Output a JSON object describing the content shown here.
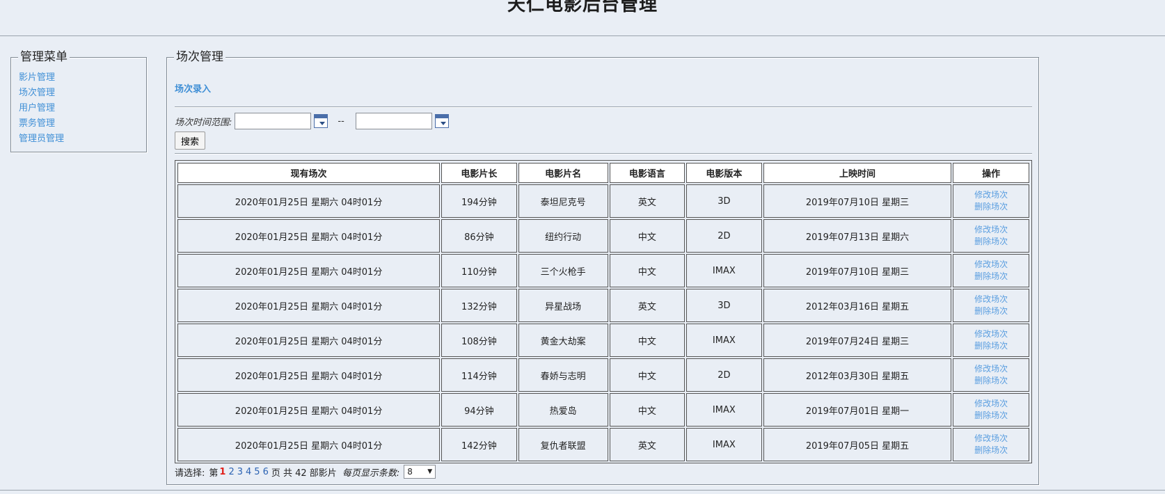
{
  "header": {
    "title": "天仁电影后台管理"
  },
  "menu": {
    "legend": "管理菜单",
    "items": [
      {
        "label": "影片管理"
      },
      {
        "label": "场次管理"
      },
      {
        "label": "用户管理"
      },
      {
        "label": "票务管理"
      },
      {
        "label": "管理员管理"
      }
    ]
  },
  "main": {
    "legend": "场次管理",
    "add_link": "场次录入",
    "filter": {
      "label": "场次时间范围:",
      "separator": "--",
      "start_value": "",
      "end_value": "",
      "search_label": "搜索"
    },
    "table": {
      "headers": [
        "现有场次",
        "电影片长",
        "电影片名",
        "电影语言",
        "电影版本",
        "上映时间",
        "操作"
      ],
      "rows": [
        {
          "session": "2020年01月25日 星期六 04时01分",
          "length": "194分钟",
          "name": "泰坦尼克号",
          "language": "英文",
          "version": "3D",
          "release": "2019年07月10日 星期三"
        },
        {
          "session": "2020年01月25日 星期六 04时01分",
          "length": "86分钟",
          "name": "纽约行动",
          "language": "中文",
          "version": "2D",
          "release": "2019年07月13日 星期六"
        },
        {
          "session": "2020年01月25日 星期六 04时01分",
          "length": "110分钟",
          "name": "三个火枪手",
          "language": "中文",
          "version": "IMAX",
          "release": "2019年07月10日 星期三"
        },
        {
          "session": "2020年01月25日 星期六 04时01分",
          "length": "132分钟",
          "name": "异星战场",
          "language": "英文",
          "version": "3D",
          "release": "2012年03月16日 星期五"
        },
        {
          "session": "2020年01月25日 星期六 04时01分",
          "length": "108分钟",
          "name": "黄金大劫案",
          "language": "中文",
          "version": "IMAX",
          "release": "2019年07月24日 星期三"
        },
        {
          "session": "2020年01月25日 星期六 04时01分",
          "length": "114分钟",
          "name": "春娇与志明",
          "language": "中文",
          "version": "2D",
          "release": "2012年03月30日 星期五"
        },
        {
          "session": "2020年01月25日 星期六 04时01分",
          "length": "94分钟",
          "name": "热爱岛",
          "language": "中文",
          "version": "IMAX",
          "release": "2019年07月01日 星期一"
        },
        {
          "session": "2020年01月25日 星期六 04时01分",
          "length": "142分钟",
          "name": "复仇者联盟",
          "language": "英文",
          "version": "IMAX",
          "release": "2019年07月05日 星期五"
        }
      ],
      "edit_label": "修改场次",
      "delete_label": "删除场次"
    },
    "pagination": {
      "prompt": "请选择:",
      "prefix": "第",
      "pages": [
        "1",
        "2",
        "3",
        "4",
        "5",
        "6"
      ],
      "current_page": "1",
      "suffix": "页 共 42 部影片",
      "per_page_label": "每页显示条数:",
      "per_page_value": "8"
    }
  }
}
